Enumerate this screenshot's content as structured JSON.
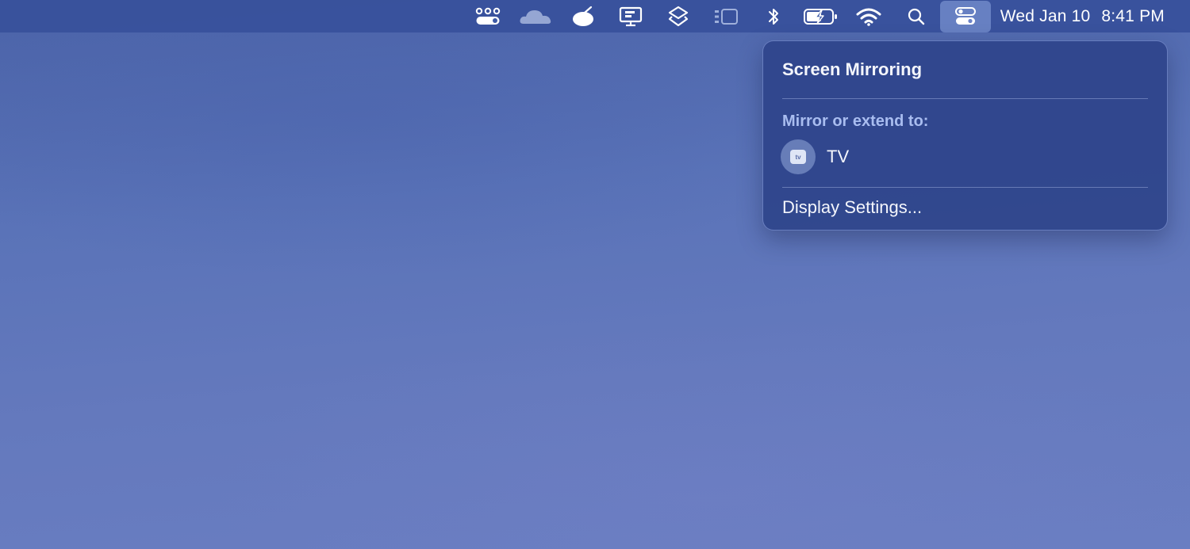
{
  "menubar": {
    "icons": [
      "toggles-dots-icon",
      "cloud-icon",
      "ufo-icon",
      "display-monitor-icon",
      "layers-icon",
      "sidebar-window-icon",
      "bluetooth-icon",
      "battery-charging-icon",
      "wifi-icon",
      "search-icon",
      "control-center-icon"
    ],
    "date": "Wed Jan 10",
    "time": "8:41 PM"
  },
  "panel": {
    "title": "Screen Mirroring",
    "section_label": "Mirror or extend to:",
    "device": {
      "icon": "apple-tv-icon",
      "icon_text": "tv",
      "label": "TV"
    },
    "settings_label": "Display Settings..."
  }
}
